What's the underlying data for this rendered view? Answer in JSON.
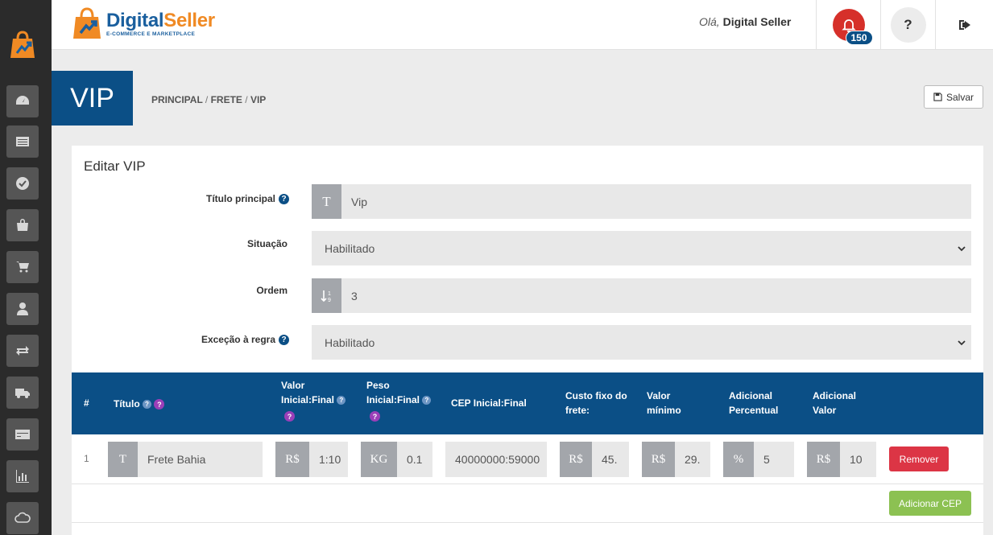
{
  "brand": {
    "name_part1": "Digital",
    "name_part2": "Seller",
    "tagline": "E-COMMERCE E MARKETPLACE",
    "primary_color": "#1a5f9e",
    "accent_color": "#f08a24"
  },
  "header": {
    "greeting": "Olá,",
    "user_name": "Digital Seller",
    "notifications_count": "150",
    "help_label": "?"
  },
  "sidebar": {
    "items": [
      "dashboard-icon",
      "list-icon",
      "check-circle-icon",
      "shopping-bag-icon",
      "cart-icon",
      "user-icon",
      "exchange-icon",
      "truck-icon",
      "credit-card-icon",
      "bar-chart-icon",
      "cloud-icon"
    ]
  },
  "page": {
    "title": "VIP",
    "breadcrumb": [
      "PRINCIPAL",
      "FRETE",
      "VIP"
    ],
    "breadcrumb_sep": "/",
    "save_label": "Salvar"
  },
  "form": {
    "heading": "Editar VIP",
    "titulo": {
      "label": "Título principal",
      "value": "Vip",
      "help": "?"
    },
    "situacao": {
      "label": "Situação",
      "value": "Habilitado"
    },
    "ordem": {
      "label": "Ordem",
      "value": "3"
    },
    "excecao": {
      "label": "Exceção à regra",
      "value": "Habilitado",
      "help": "?"
    }
  },
  "table": {
    "headers": {
      "num": "#",
      "titulo": "Título",
      "valor_l1": "Valor",
      "valor_l2": "Inicial:Final",
      "peso_l1": "Peso",
      "peso_l2": "Inicial:Final",
      "cep": "CEP Inicial:Final",
      "custo_l1": "Custo fixo do",
      "custo_l2": "frete:",
      "minimo_l1": "Valor",
      "minimo_l2": "mínimo",
      "percentual_l1": "Adicional",
      "percentual_l2": "Percentual",
      "adicional_l1": "Adicional",
      "adicional_l2": "Valor",
      "q": "?"
    },
    "rows": [
      {
        "num": "1",
        "titulo": "Frete Bahia",
        "valor_prefix": "R$",
        "valor": "1:10",
        "peso_prefix": "KG",
        "peso": "0.1",
        "cep": "40000000:59000",
        "custo_prefix": "R$",
        "custo": "45.",
        "minimo_prefix": "R$",
        "minimo": "29.",
        "percentual_prefix": "%",
        "percentual": "5",
        "adicional_prefix": "R$",
        "adicional": "10",
        "remove_label": "Remover"
      }
    ],
    "add_label": "Adicionar CEP"
  }
}
